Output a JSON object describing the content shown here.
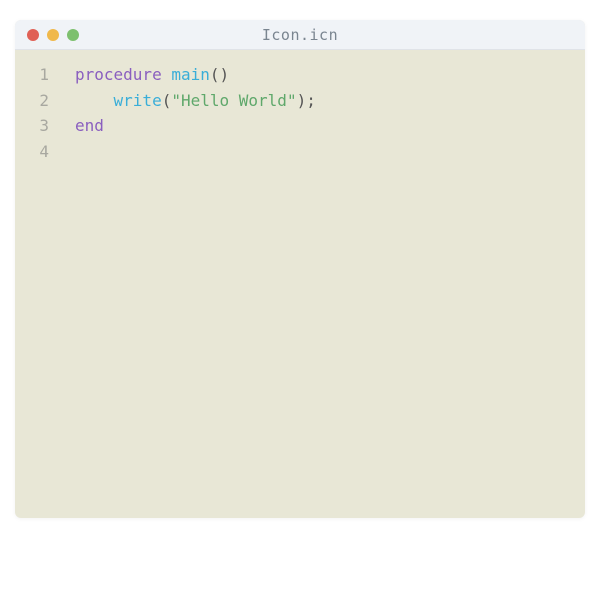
{
  "window": {
    "title": "Icon.icn"
  },
  "trafficLights": {
    "close": "close-icon",
    "minimize": "minimize-icon",
    "maximize": "maximize-icon"
  },
  "colors": {
    "background": "#e8e7d6",
    "titleBar": "#f0f3f7",
    "keyword": "#8a5fbf",
    "identifier": "#3aaed8",
    "string": "#5fa86b",
    "gutter": "#a8a8a0"
  },
  "gutter": [
    "1",
    "2",
    "3",
    "4"
  ],
  "code": {
    "line1": {
      "kw": "procedure ",
      "ident": "main",
      "punc": "()"
    },
    "line2": {
      "indent": "    ",
      "ident": "write",
      "open": "(",
      "str": "\"Hello World\"",
      "close": ");"
    },
    "line3": {
      "kw": "end"
    },
    "line4": {
      "empty": " "
    }
  }
}
